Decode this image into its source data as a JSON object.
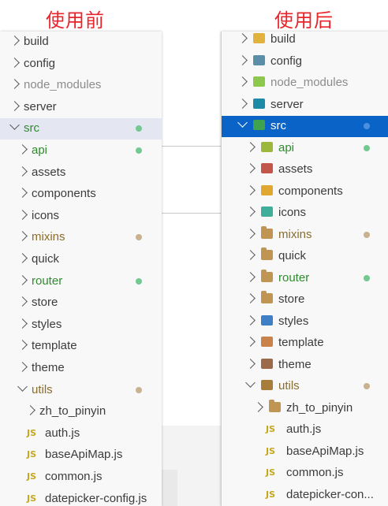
{
  "titles": {
    "before": "使用前",
    "after": "使用后"
  },
  "colors": {
    "muted_text": "#8c8c8c",
    "green_text": "#2e8b2e",
    "olive_text": "#8a6d2d",
    "green_dot": "#73c991",
    "tan_dot": "#c8b28f",
    "blue_dot": "#4a90e2",
    "selection_left": "#e4e6f1",
    "selection_right": "#0a64c8",
    "js_badge": "#c6a71d"
  },
  "before_tree": [
    {
      "label": "build",
      "kind": "folder",
      "state": "closed",
      "depth": 0
    },
    {
      "label": "config",
      "kind": "folder",
      "state": "closed",
      "depth": 0
    },
    {
      "label": "node_modules",
      "kind": "folder",
      "state": "closed",
      "depth": 0,
      "muted": true
    },
    {
      "label": "server",
      "kind": "folder",
      "state": "closed",
      "depth": 0
    },
    {
      "label": "src",
      "kind": "folder",
      "state": "open",
      "depth": 0,
      "dot": "green",
      "selected": true
    },
    {
      "label": "api",
      "kind": "folder",
      "state": "closed",
      "depth": 1,
      "dot": "green",
      "tone": "green"
    },
    {
      "label": "assets",
      "kind": "folder",
      "state": "closed",
      "depth": 1
    },
    {
      "label": "components",
      "kind": "folder",
      "state": "closed",
      "depth": 1
    },
    {
      "label": "icons",
      "kind": "folder",
      "state": "closed",
      "depth": 1
    },
    {
      "label": "mixins",
      "kind": "folder",
      "state": "closed",
      "depth": 1,
      "dot": "tan",
      "tone": "olive"
    },
    {
      "label": "quick",
      "kind": "folder",
      "state": "closed",
      "depth": 1
    },
    {
      "label": "router",
      "kind": "folder",
      "state": "closed",
      "depth": 1,
      "dot": "green",
      "tone": "green"
    },
    {
      "label": "store",
      "kind": "folder",
      "state": "closed",
      "depth": 1
    },
    {
      "label": "styles",
      "kind": "folder",
      "state": "closed",
      "depth": 1
    },
    {
      "label": "template",
      "kind": "folder",
      "state": "closed",
      "depth": 1
    },
    {
      "label": "theme",
      "kind": "folder",
      "state": "closed",
      "depth": 1
    },
    {
      "label": "utils",
      "kind": "folder",
      "state": "open",
      "depth": 1,
      "dot": "tan",
      "tone": "olive"
    },
    {
      "label": "zh_to_pinyin",
      "kind": "folder",
      "state": "closed",
      "depth": 2
    },
    {
      "label": "auth.js",
      "kind": "js",
      "depth": 2
    },
    {
      "label": "baseApiMap.js",
      "kind": "js",
      "depth": 2
    },
    {
      "label": "common.js",
      "kind": "js",
      "depth": 2
    },
    {
      "label": "datepicker-config.js",
      "kind": "js",
      "depth": 2
    }
  ],
  "after_tree": [
    {
      "label": "build",
      "kind": "folder",
      "state": "closed",
      "depth": 0,
      "icon": "build-folder-icon",
      "icon_color": "#e2b33c"
    },
    {
      "label": "config",
      "kind": "folder",
      "state": "closed",
      "depth": 0,
      "icon": "config-folder-icon",
      "icon_color": "#5b8fa8"
    },
    {
      "label": "node_modules",
      "kind": "folder",
      "state": "closed",
      "depth": 0,
      "muted": true,
      "icon": "node-modules-folder-icon",
      "icon_color": "#8cc84b"
    },
    {
      "label": "server",
      "kind": "folder",
      "state": "closed",
      "depth": 0,
      "icon": "server-folder-icon",
      "icon_color": "#1d8aa6"
    },
    {
      "label": "src",
      "kind": "folder",
      "state": "open",
      "depth": 0,
      "dot": "blue",
      "selected": true,
      "icon": "src-folder-icon",
      "icon_color": "#3fa34d"
    },
    {
      "label": "api",
      "kind": "folder",
      "state": "closed",
      "depth": 1,
      "dot": "green",
      "tone": "green",
      "icon": "api-folder-icon",
      "icon_color": "#9bb83c"
    },
    {
      "label": "assets",
      "kind": "folder",
      "state": "closed",
      "depth": 1,
      "icon": "assets-folder-icon",
      "icon_color": "#c2564b"
    },
    {
      "label": "components",
      "kind": "folder",
      "state": "closed",
      "depth": 1,
      "icon": "components-folder-icon",
      "icon_color": "#e0a830"
    },
    {
      "label": "icons",
      "kind": "folder",
      "state": "closed",
      "depth": 1,
      "icon": "icons-folder-icon",
      "icon_color": "#3fae9a"
    },
    {
      "label": "mixins",
      "kind": "folder",
      "state": "closed",
      "depth": 1,
      "dot": "tan",
      "tone": "olive",
      "icon": "mixins-folder-icon",
      "icon_color": "#c09553"
    },
    {
      "label": "quick",
      "kind": "folder",
      "state": "closed",
      "depth": 1,
      "icon": "quick-folder-icon",
      "icon_color": "#c09553"
    },
    {
      "label": "router",
      "kind": "folder",
      "state": "closed",
      "depth": 1,
      "dot": "green",
      "tone": "green",
      "icon": "router-folder-icon",
      "icon_color": "#c09553"
    },
    {
      "label": "store",
      "kind": "folder",
      "state": "closed",
      "depth": 1,
      "icon": "store-folder-icon",
      "icon_color": "#c09553"
    },
    {
      "label": "styles",
      "kind": "folder",
      "state": "closed",
      "depth": 1,
      "icon": "styles-folder-icon",
      "icon_color": "#3e7fc6"
    },
    {
      "label": "template",
      "kind": "folder",
      "state": "closed",
      "depth": 1,
      "icon": "template-folder-icon",
      "icon_color": "#c9834a"
    },
    {
      "label": "theme",
      "kind": "folder",
      "state": "closed",
      "depth": 1,
      "icon": "theme-folder-icon",
      "icon_color": "#9a6a4a"
    },
    {
      "label": "utils",
      "kind": "folder",
      "state": "open",
      "depth": 1,
      "dot": "tan",
      "tone": "olive",
      "icon": "utils-folder-icon",
      "icon_color": "#a87d3c"
    },
    {
      "label": "zh_to_pinyin",
      "kind": "folder",
      "state": "closed",
      "depth": 2,
      "icon": "folder-icon",
      "icon_color": "#c09553"
    },
    {
      "label": "auth.js",
      "kind": "js",
      "depth": 2
    },
    {
      "label": "baseApiMap.js",
      "kind": "js",
      "depth": 2
    },
    {
      "label": "common.js",
      "kind": "js",
      "depth": 2
    },
    {
      "label": "datepicker-con...",
      "kind": "js",
      "depth": 2
    }
  ],
  "js_badge": "JS"
}
